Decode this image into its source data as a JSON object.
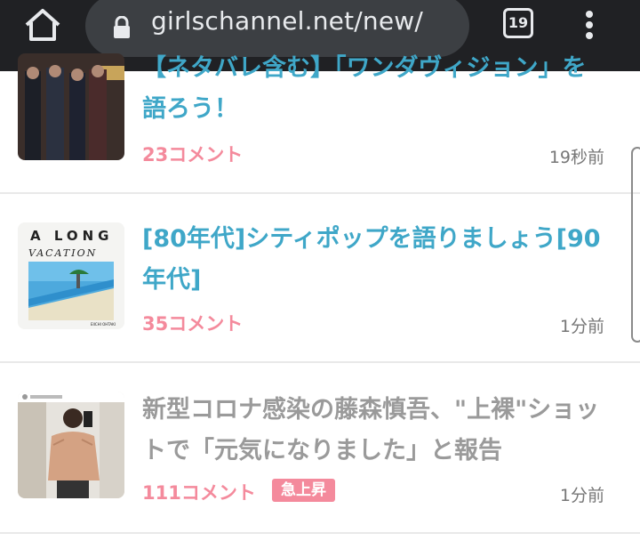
{
  "browser": {
    "url": "girlschannel.net/new/",
    "tab_count": "19",
    "colors": {
      "toolbar": "#202124",
      "urlbar": "#3c3f43",
      "text": "#e8eaed"
    }
  },
  "articles": [
    {
      "title": "【ネタバレ含む】「ワンダヴィジョン」を語ろう！",
      "comments": "23コメント",
      "time": "19秒前"
    },
    {
      "title": "[80年代]シティポップを語りましょう[90年代]",
      "comments": "35コメント",
      "time": "1分前",
      "thumb_text": {
        "line1": "A LONG",
        "line2": "VACATION",
        "artist": "EIICHI OHTAKI"
      }
    },
    {
      "title": "新型コロナ感染の藤森慎吾、\"上裸\"ショットで「元気になりました」と報告",
      "comments": "111コメント",
      "time": "1分前",
      "badge": "急上昇"
    }
  ],
  "colors": {
    "title_link": "#3fa7c8",
    "title_visited": "#9a9a9a",
    "comment_pink": "#f48a9c"
  }
}
